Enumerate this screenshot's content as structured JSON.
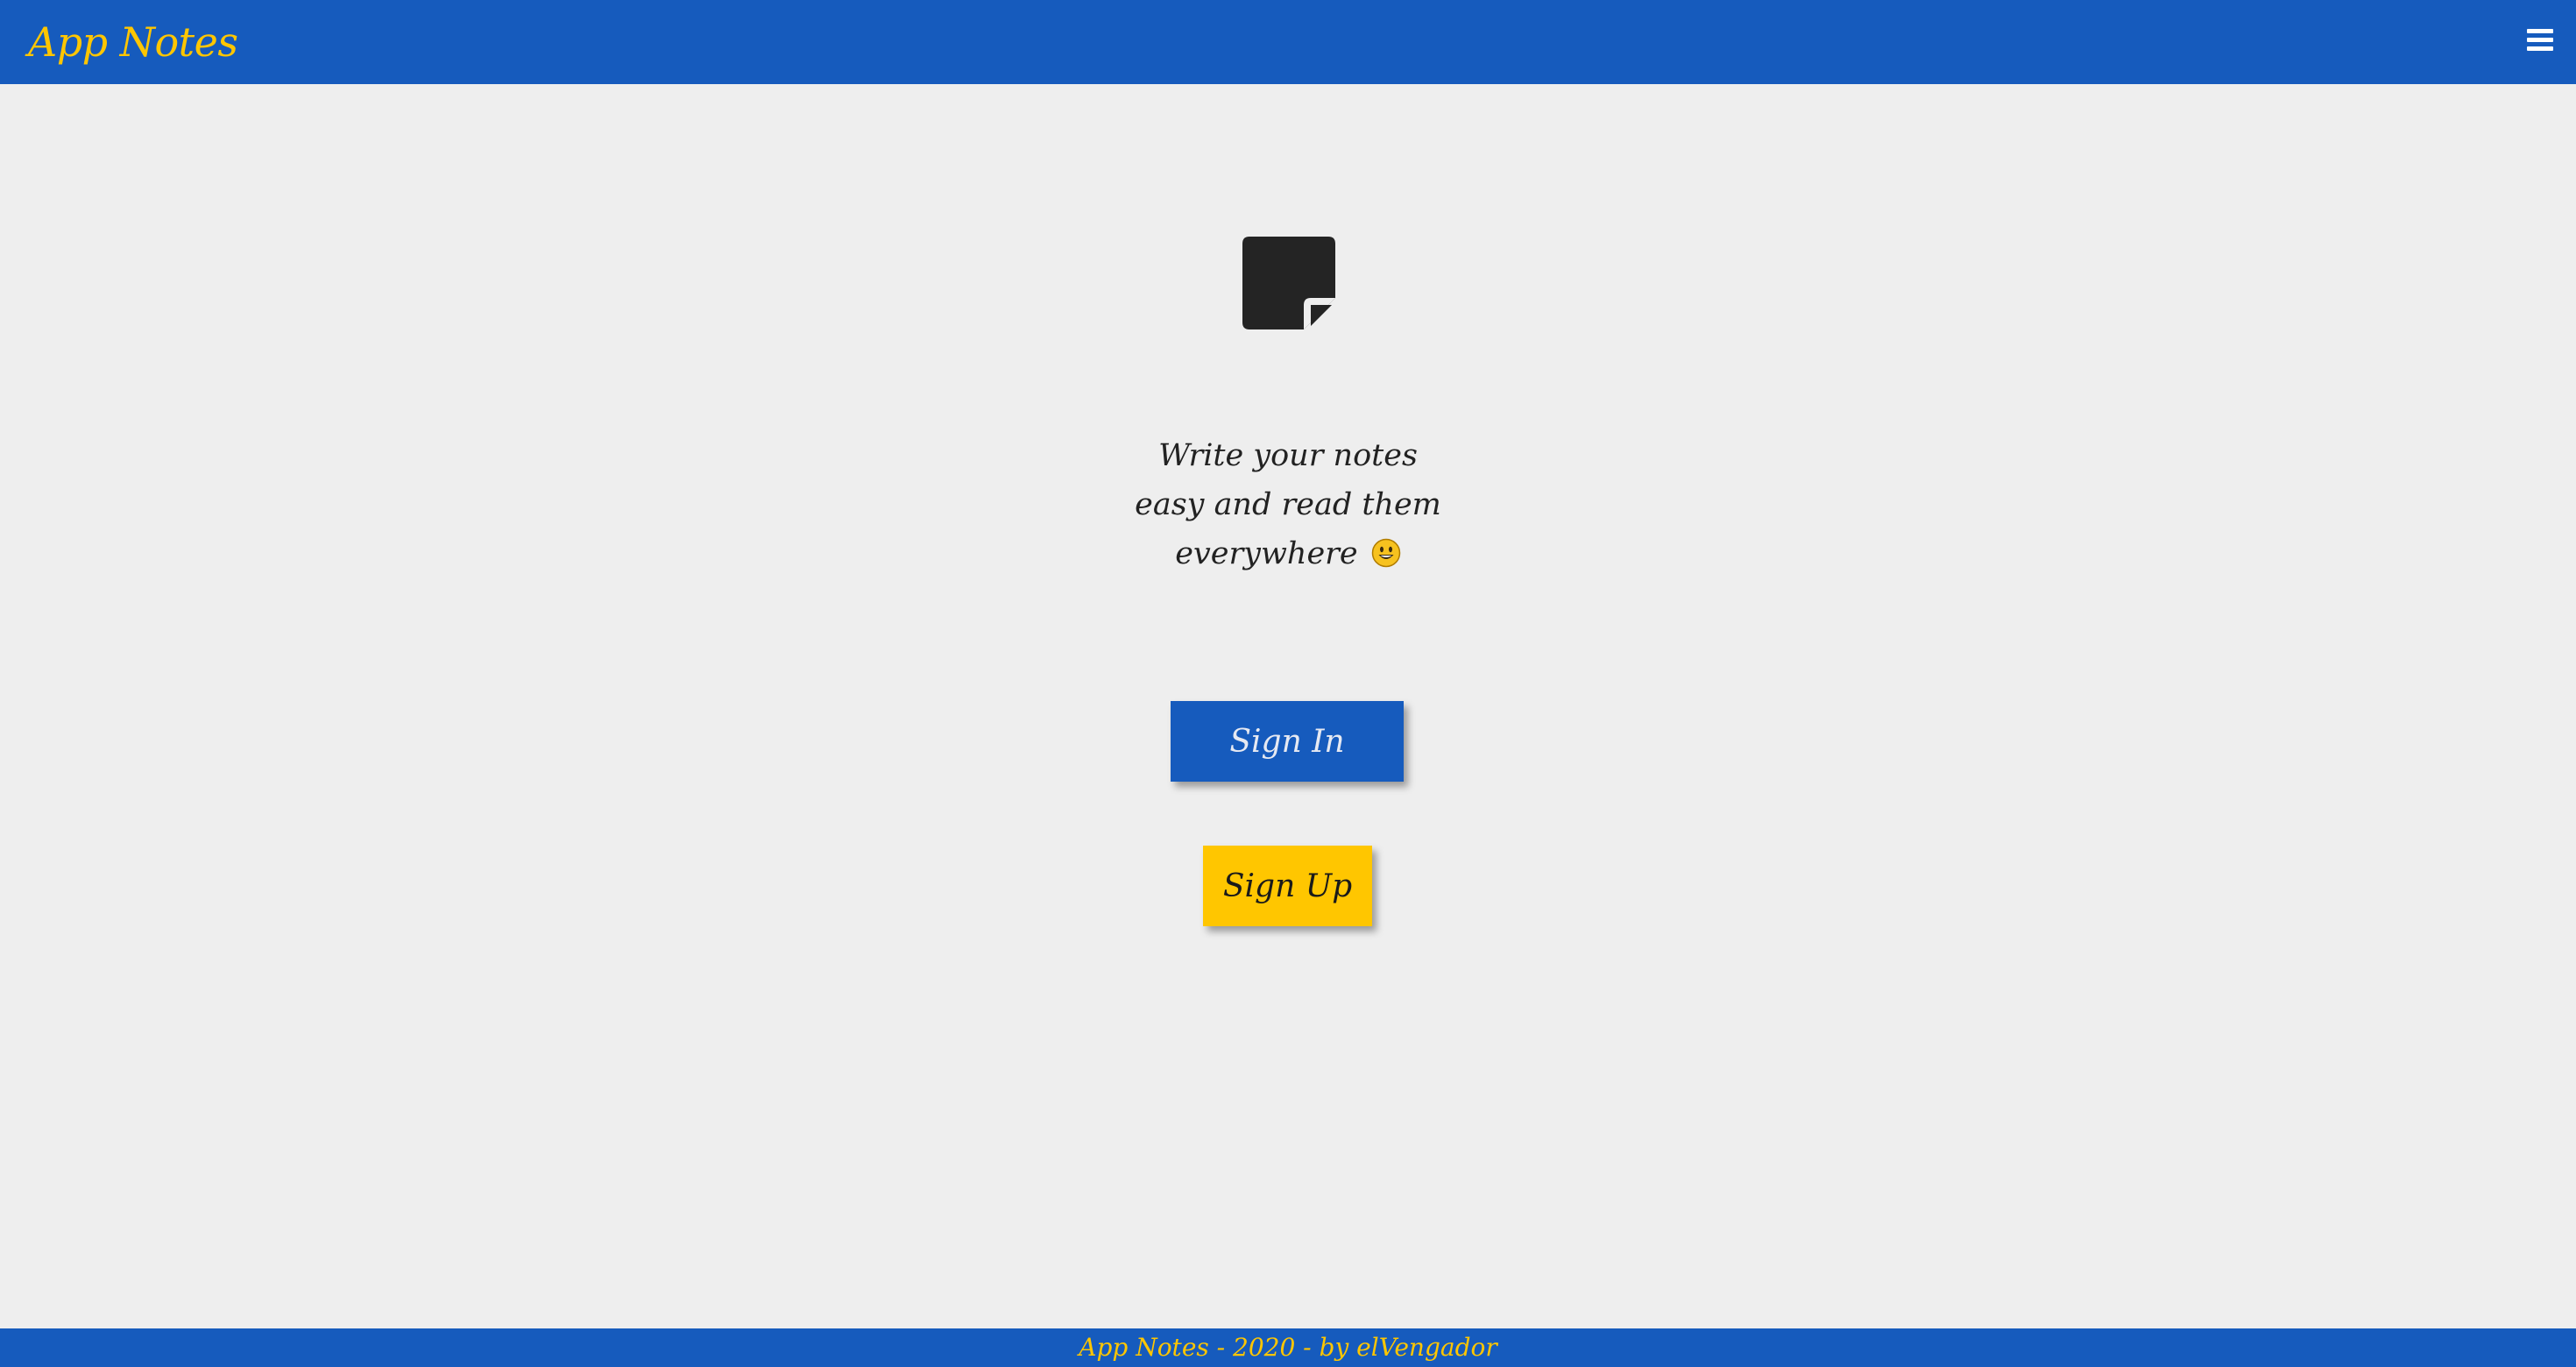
{
  "header": {
    "brand": "App Notes",
    "menu_icon": "hamburger-menu-icon"
  },
  "hero": {
    "icon": "sticky-note-icon",
    "tagline_lines": [
      "Write your notes",
      "easy and read them",
      "everywhere"
    ],
    "emoji_icon": "smiley-face-icon"
  },
  "actions": {
    "sign_in_label": "Sign In",
    "sign_up_label": "Sign Up"
  },
  "footer": {
    "text": "App Notes - 2020 - by elVengador"
  },
  "colors": {
    "primary_blue": "#165bbd",
    "accent_yellow": "#ffc600",
    "background": "#eeeeee",
    "text_dark": "#222222"
  }
}
